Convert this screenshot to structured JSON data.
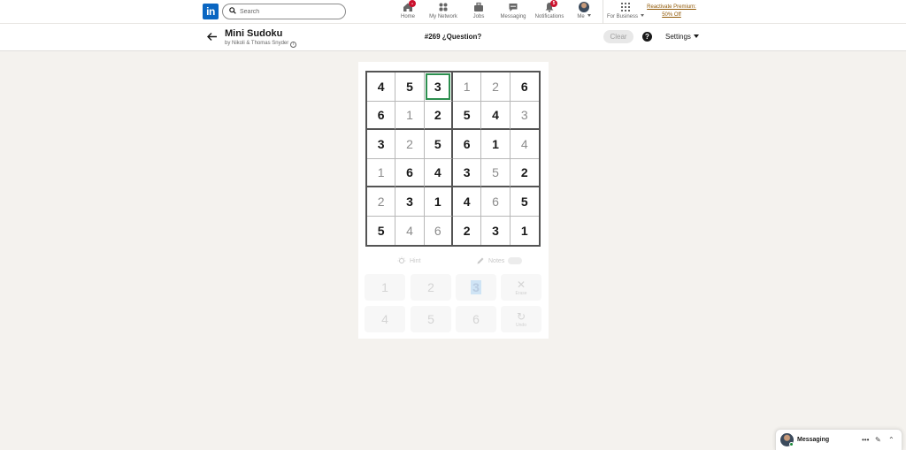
{
  "nav": {
    "logo": "in",
    "search_placeholder": "Search",
    "items": [
      {
        "label": "Home",
        "icon": "home-icon",
        "badge": "●"
      },
      {
        "label": "My Network",
        "icon": "network-icon"
      },
      {
        "label": "Jobs",
        "icon": "briefcase-icon"
      },
      {
        "label": "Messaging",
        "icon": "chat-icon"
      },
      {
        "label": "Notifications",
        "icon": "bell-icon",
        "badge": "5"
      },
      {
        "label": "Me",
        "icon": "avatar"
      },
      {
        "label": "For Business",
        "icon": "grid-icon"
      }
    ],
    "premium_line1": "Reactivate Premium:",
    "premium_line2": "50% Off"
  },
  "game": {
    "title": "Mini Sudoku",
    "author": "by Nikoli & Thomas Snyder",
    "puzzle_name": "#269 ¿Question?",
    "clear_label": "Clear",
    "help_label": "?",
    "settings_label": "Settings"
  },
  "board": {
    "cells": [
      [
        "4",
        "5",
        "3",
        "1",
        "2",
        "6"
      ],
      [
        "6",
        "1",
        "2",
        "5",
        "4",
        "3"
      ],
      [
        "3",
        "2",
        "5",
        "6",
        "1",
        "4"
      ],
      [
        "1",
        "6",
        "4",
        "3",
        "5",
        "2"
      ],
      [
        "2",
        "3",
        "1",
        "4",
        "6",
        "5"
      ],
      [
        "5",
        "4",
        "6",
        "2",
        "3",
        "1"
      ]
    ],
    "given": [
      [
        1,
        1,
        1,
        0,
        0,
        1
      ],
      [
        1,
        0,
        1,
        1,
        1,
        0
      ],
      [
        1,
        0,
        1,
        1,
        1,
        0
      ],
      [
        0,
        1,
        1,
        1,
        0,
        1
      ],
      [
        0,
        1,
        1,
        1,
        0,
        1
      ],
      [
        1,
        0,
        0,
        1,
        1,
        1
      ]
    ],
    "selected": [
      0,
      2
    ]
  },
  "tools": {
    "hint_label": "Hint",
    "notes_label": "Notes"
  },
  "keypad": {
    "keys": [
      "1",
      "2",
      "3",
      "4",
      "5",
      "6"
    ],
    "active_key": "3",
    "erase_label": "Erase",
    "undo_label": "Undo"
  },
  "messaging": {
    "label": "Messaging"
  },
  "colors": {
    "linkedin_blue": "#0a66c2",
    "selection_green": "#2c8f4f",
    "premium_gold": "#915907"
  }
}
